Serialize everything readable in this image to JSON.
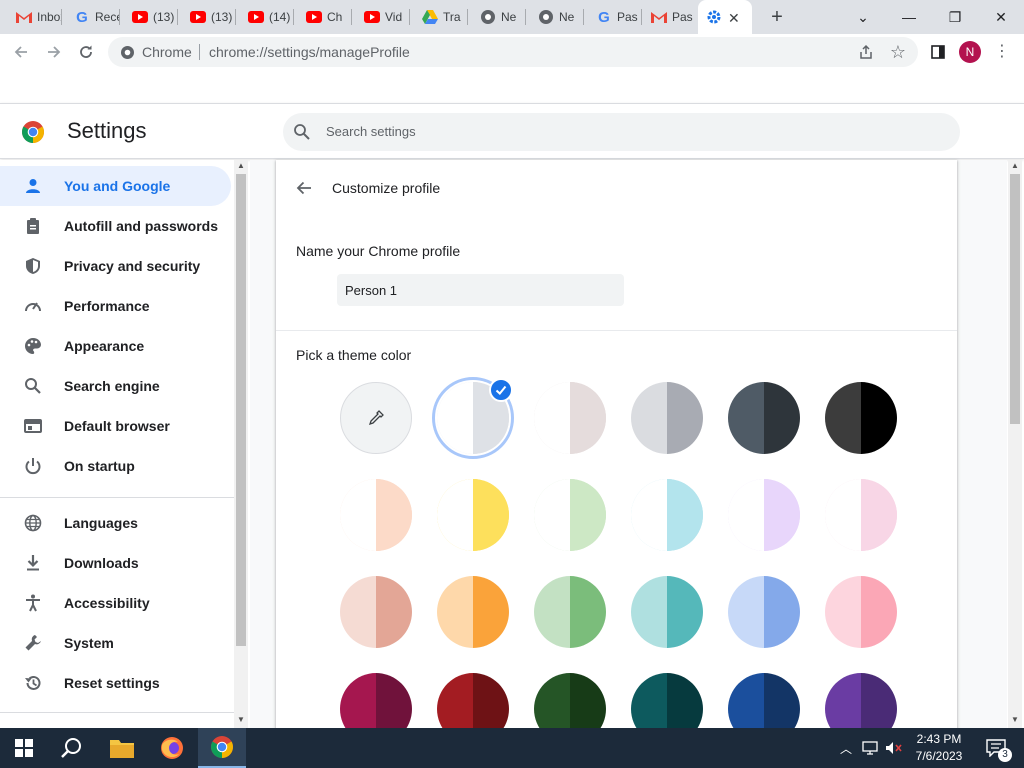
{
  "browser": {
    "tabs": [
      {
        "title": "Inbox",
        "icon": "gmail-icon"
      },
      {
        "title": "Recent",
        "icon": "google-icon"
      },
      {
        "title": "(13)",
        "icon": "youtube-icon"
      },
      {
        "title": "(13)",
        "icon": "youtube-icon"
      },
      {
        "title": "(14)",
        "icon": "youtube-icon"
      },
      {
        "title": "Ch",
        "icon": "youtube-icon"
      },
      {
        "title": "Vid",
        "icon": "youtube-icon"
      },
      {
        "title": "Tra",
        "icon": "drive-icon"
      },
      {
        "title": "Ne",
        "icon": "chromium-icon"
      },
      {
        "title": "Ne",
        "icon": "chromium-icon"
      },
      {
        "title": "Pas",
        "icon": "google-icon"
      },
      {
        "title": "Pas",
        "icon": "gmail-icon"
      },
      {
        "title": "",
        "icon": "settings-gear-icon",
        "active": true
      }
    ],
    "omnibox": {
      "chip": "Chrome",
      "url": "chrome://settings/manageProfile"
    },
    "profile_initial": "N"
  },
  "settings": {
    "title": "Settings",
    "search_placeholder": "Search settings",
    "sidebar": {
      "items": [
        {
          "label": "You and Google",
          "icon": "person-icon",
          "selected": true
        },
        {
          "label": "Autofill and passwords",
          "icon": "clipboard-icon"
        },
        {
          "label": "Privacy and security",
          "icon": "shield-icon"
        },
        {
          "label": "Performance",
          "icon": "speedometer-icon"
        },
        {
          "label": "Appearance",
          "icon": "palette-icon"
        },
        {
          "label": "Search engine",
          "icon": "search-icon"
        },
        {
          "label": "Default browser",
          "icon": "browser-window-icon"
        },
        {
          "label": "On startup",
          "icon": "power-icon"
        },
        {
          "label": "Languages",
          "icon": "globe-icon"
        },
        {
          "label": "Downloads",
          "icon": "download-icon"
        },
        {
          "label": "Accessibility",
          "icon": "accessibility-icon"
        },
        {
          "label": "System",
          "icon": "wrench-icon"
        },
        {
          "label": "Reset settings",
          "icon": "reset-history-icon"
        }
      ]
    },
    "customize": {
      "title": "Customize profile",
      "name_label": "Name your Chrome profile",
      "name_value": "Person 1",
      "theme_label": "Pick a theme color",
      "swatches": [
        {
          "left": "#ffffff",
          "right": "#f1f3f4",
          "custom": true
        },
        {
          "left": "#ffffff",
          "right": "#dee1e6",
          "selected": true
        },
        {
          "left": "#ffffff",
          "right": "#e5dcdc"
        },
        {
          "left": "#dadce0",
          "right": "#a8abb3"
        },
        {
          "left": "#4f5b66",
          "right": "#2e353b"
        },
        {
          "left": "#3c3c3c",
          "right": "#000000"
        },
        {
          "left": "#ffffff",
          "right": "#fcdac8"
        },
        {
          "left": "#ffffff",
          "right": "#fde05c"
        },
        {
          "left": "#ffffff",
          "right": "#cde8c5"
        },
        {
          "left": "#ffffff",
          "right": "#b3e4ed"
        },
        {
          "left": "#ffffff",
          "right": "#e8d6fb"
        },
        {
          "left": "#ffffff",
          "right": "#f8d6e6"
        },
        {
          "left": "#f5dbd3",
          "right": "#e3a696"
        },
        {
          "left": "#fed8aa",
          "right": "#faa33a"
        },
        {
          "left": "#c3e1c3",
          "right": "#7bbd7b"
        },
        {
          "left": "#afe0e0",
          "right": "#55b8ba"
        },
        {
          "left": "#c7d9f8",
          "right": "#84a9ea"
        },
        {
          "left": "#fdd5de",
          "right": "#fba7b6"
        },
        {
          "left": "#a5174f",
          "right": "#70123b"
        },
        {
          "left": "#a31c22",
          "right": "#6e1215"
        },
        {
          "left": "#255526",
          "right": "#173b17"
        },
        {
          "left": "#0d5a5e",
          "right": "#063a3e"
        },
        {
          "left": "#1b4f9d",
          "right": "#133566"
        },
        {
          "left": "#6a3ca3",
          "right": "#4a2b76"
        }
      ]
    }
  },
  "taskbar": {
    "time": "2:43 PM",
    "date": "7/6/2023",
    "notification_count": "3"
  }
}
